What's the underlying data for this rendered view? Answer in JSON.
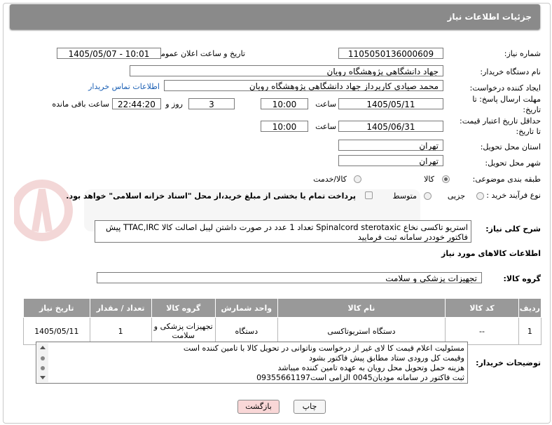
{
  "header": {
    "title": "جزئیات اطلاعات نیاز"
  },
  "fields": {
    "need_number_label": "شماره نیاز:",
    "need_number": "1105050136000609",
    "announce_label": "تاریخ و ساعت اعلان عمومی:",
    "announce_value": "1405/05/07 - 10:01",
    "buyer_org_label": "نام دستگاه خریدار:",
    "buyer_org": "جهاد دانشگاهی پژوهشگاه رویان",
    "creator_label": "ایجاد کننده درخواست:",
    "creator": "محمد صیادی کارپرداز جهاد دانشگاهی پژوهشگاه رویان",
    "contact_link": "اطلاعات تماس خریدار",
    "deadline_label": "مهلت ارسال پاسخ: تا تاریخ:",
    "deadline_date": "1405/05/11",
    "time_label": "ساعت",
    "deadline_time": "10:00",
    "days_value": "3",
    "days_label": "روز و",
    "remaining_time": "22:44:20",
    "remaining_label": "ساعت باقی مانده",
    "validity_label": "حداقل تاریخ اعتبار قیمت: تا تاریخ:",
    "validity_date": "1405/06/31",
    "validity_time": "10:00",
    "province_label": "استان محل تحویل:",
    "province": "تهران",
    "city_label": "شهر محل تحویل:",
    "city": "تهران",
    "category_label": "طبقه بندی موضوعی:",
    "cat_goods": "کالا",
    "cat_goods_service": "کالا/خدمت",
    "process_label": "نوع فرآیند خرید :",
    "proc_minor": "جزیی",
    "proc_medium": "متوسط",
    "payment_note": "پرداخت تمام یا بخشی از مبلغ خرید،از محل \"اسناد خزانه اسلامی\" خواهد بود."
  },
  "summary": {
    "label": "شرح کلی نیاز:",
    "line1": "استریو تاکسی نخاع Spinalcord sterotaxic   تعداد 1 عدد در صورت داشتن لیبل اصالت کالا TTAC,IRC پیش",
    "line2": "فاکتور خوددر سامانه ثبت فرمایید"
  },
  "goods_info_title": "اطلاعات کالاهای مورد نیاز",
  "goods_group_label": "گروه کالا:",
  "goods_group": "تجهیزات پزشکی و سلامت",
  "table": {
    "headers": [
      "ردیف",
      "کد کالا",
      "نام کالا",
      "واحد شمارش",
      "گروه کالا",
      "تعداد / مقدار",
      "تاریخ نیاز"
    ],
    "rows": [
      {
        "idx": "1",
        "code": "--",
        "name": "دستگاه استریوتاکسی",
        "unit": "دستگاه",
        "group": "تجهیزات پزشکی و سلامت",
        "qty": "1",
        "date": "1405/05/11"
      }
    ]
  },
  "buyer_notes": {
    "label": "توضیحات خریدار:",
    "lines": [
      "مسئولیت اعلام قیمت کا لای  غیر از درخواست وناتوانی در تحویل کالا با تامین کننده است",
      "وقیمت کل ورودی ستاد مطابق پیش فاکتور بشود",
      "هزینه حمل وتحویل محل رویان به عهده تامین کننده میباشد",
      "ثبت فاکتور در سامانه مودیان0045 الزامی است09355661197"
    ]
  },
  "buttons": {
    "print": "چاپ",
    "back": "بازگشت"
  },
  "colors": {
    "header_bg": "#8a8a8a",
    "table_header_bg": "#999999",
    "link": "#1a5fb4",
    "back_btn_bg": "#f9d7d7"
  }
}
